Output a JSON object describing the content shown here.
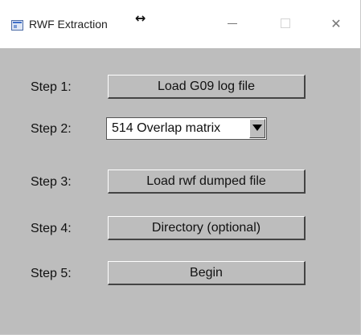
{
  "window": {
    "title": "RWF Extraction",
    "resize_cursor": "↔",
    "close_glyph": "✕"
  },
  "steps": [
    {
      "label": "Step 1:",
      "control": "button",
      "text": "Load G09 log file"
    },
    {
      "label": "Step 2:",
      "control": "dropdown",
      "text": "514 Overlap matrix"
    },
    {
      "label": "Step 3:",
      "control": "button",
      "text": "Load rwf dumped file"
    },
    {
      "label": "Step 4:",
      "control": "button",
      "text": "Directory (optional)"
    },
    {
      "label": "Step 5:",
      "control": "button",
      "text": "Begin"
    }
  ],
  "icons": {
    "app": "app-window-icon",
    "minimize": "minimize-icon",
    "maximize": "maximize-icon",
    "close": "close-icon",
    "dropdown": "chevron-down-icon",
    "cursor": "resize-horizontal-cursor-icon"
  },
  "colors": {
    "window_bg": "#bdbdbd",
    "titlebar_bg": "#ffffff",
    "text": "#111111"
  }
}
